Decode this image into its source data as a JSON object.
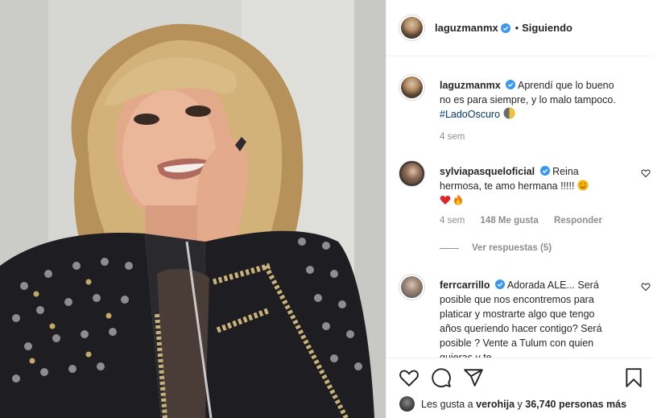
{
  "header": {
    "username": "laguzmanmx",
    "separator": "•",
    "follow_status": "Siguiendo"
  },
  "caption": {
    "username": "laguzmanmx",
    "text": "Aprendí que lo bueno no es para siempre, y lo malo tampoco.",
    "hashtag": "#LadoOscuro",
    "time": "4 sem"
  },
  "comments": [
    {
      "username": "sylviapasqueloficial",
      "text": "Reina hermosa, te amo hermana !!!!!",
      "time": "4 sem",
      "likes": "148 Me gusta",
      "reply_label": "Responder",
      "view_replies": "Ver respuestas (5)"
    },
    {
      "username": "ferrcarrillo",
      "text": "Adorada ALE... Será posible que nos encontremos para platicar y mostrarte algo que tengo años queriendo hacer contigo? Será posible ? Vente a Tulum con quien quieras y te"
    }
  ],
  "footer": {
    "liked_prefix": "Les gusta a",
    "liked_user": "verohija",
    "liked_middle": "y",
    "liked_count": "36,740 personas más"
  },
  "icons": {
    "like": "heart-icon",
    "comment": "comment-icon",
    "share": "share-icon",
    "save": "bookmark-icon",
    "verified": "verified-badge-icon"
  },
  "colors": {
    "verified": "#3897f0",
    "text": "#262626",
    "muted": "#8e8e8e",
    "hashtag": "#00376b"
  }
}
